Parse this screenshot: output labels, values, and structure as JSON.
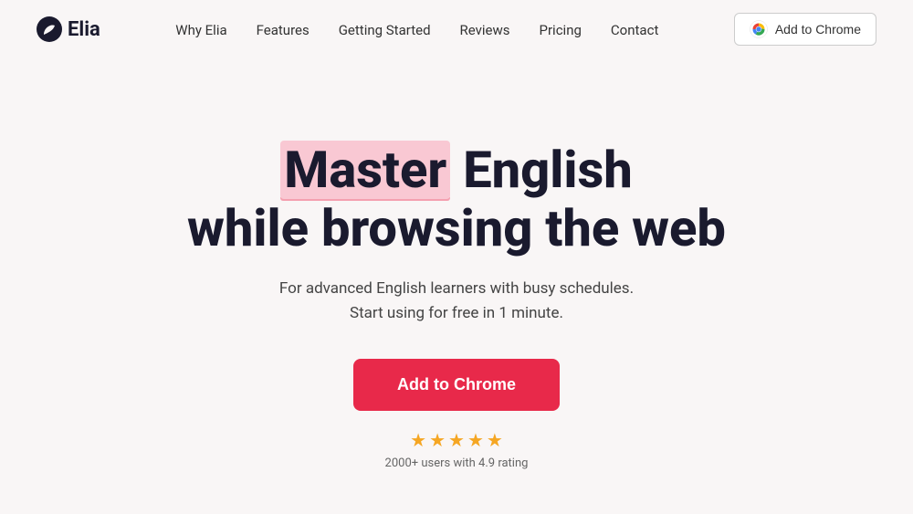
{
  "logo": {
    "text": "Elia"
  },
  "nav": {
    "links": [
      {
        "label": "Why Elia",
        "id": "why-elia"
      },
      {
        "label": "Features",
        "id": "features"
      },
      {
        "label": "Getting Started",
        "id": "getting-started"
      },
      {
        "label": "Reviews",
        "id": "reviews"
      },
      {
        "label": "Pricing",
        "id": "pricing"
      },
      {
        "label": "Contact",
        "id": "contact"
      }
    ],
    "cta_label": "Add to Chrome"
  },
  "hero": {
    "title_word_highlight": "Master",
    "title_rest_line1": " English",
    "title_line2": "while browsing the web",
    "subtitle_line1": "For advanced English learners with busy schedules.",
    "subtitle_line2": "Start using for free in 1 minute.",
    "cta_label": "Add to Chrome",
    "rating_text": "2000+ users with 4.9 rating",
    "stars_count": 5
  },
  "colors": {
    "accent": "#e8294a",
    "highlight_bg": "#f9c8d3",
    "star_color": "#f5a623"
  }
}
